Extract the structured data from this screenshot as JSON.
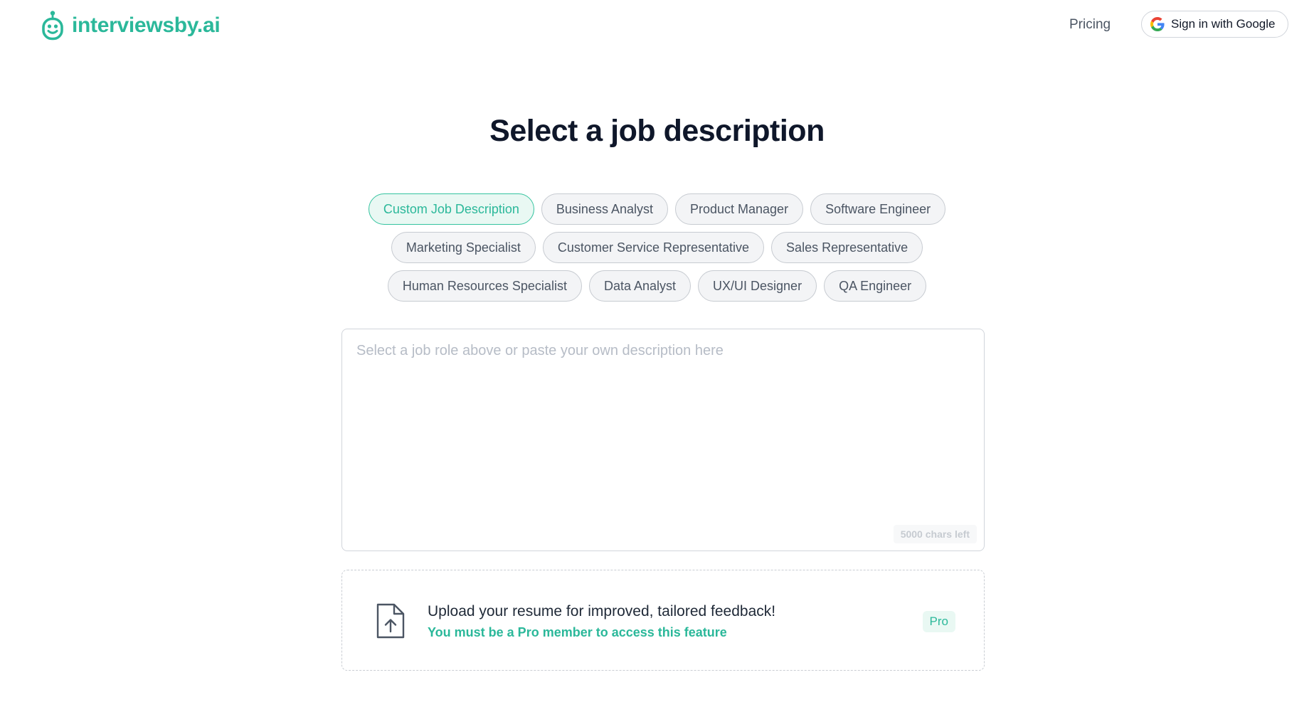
{
  "header": {
    "brand": "interviewsby.ai",
    "pricing_label": "Pricing",
    "signin_label": "Sign in with Google"
  },
  "main": {
    "title": "Select a job description",
    "chip_rows": [
      [
        "Custom Job Description",
        "Business Analyst",
        "Product Manager",
        "Software Engineer"
      ],
      [
        "Marketing Specialist",
        "Customer Service Representative",
        "Sales Representative"
      ],
      [
        "Human Resources Specialist",
        "Data Analyst",
        "UX/UI Designer",
        "QA Engineer"
      ]
    ],
    "selected_chip": "Custom Job Description",
    "description": {
      "value": "",
      "placeholder": "Select a job role above or paste your own description here",
      "chars_left": "5000 chars left"
    },
    "upload": {
      "title": "Upload your resume for improved, tailored feedback!",
      "subtitle": "You must be a Pro member to access this feature",
      "badge": "Pro"
    }
  },
  "colors": {
    "accent": "#2bb89a",
    "accent_light": "#e9f8f3",
    "title": "#0f172a"
  },
  "icons": {
    "logo": "robot-logo-icon",
    "google": "google-icon",
    "upload": "file-upload-icon"
  }
}
